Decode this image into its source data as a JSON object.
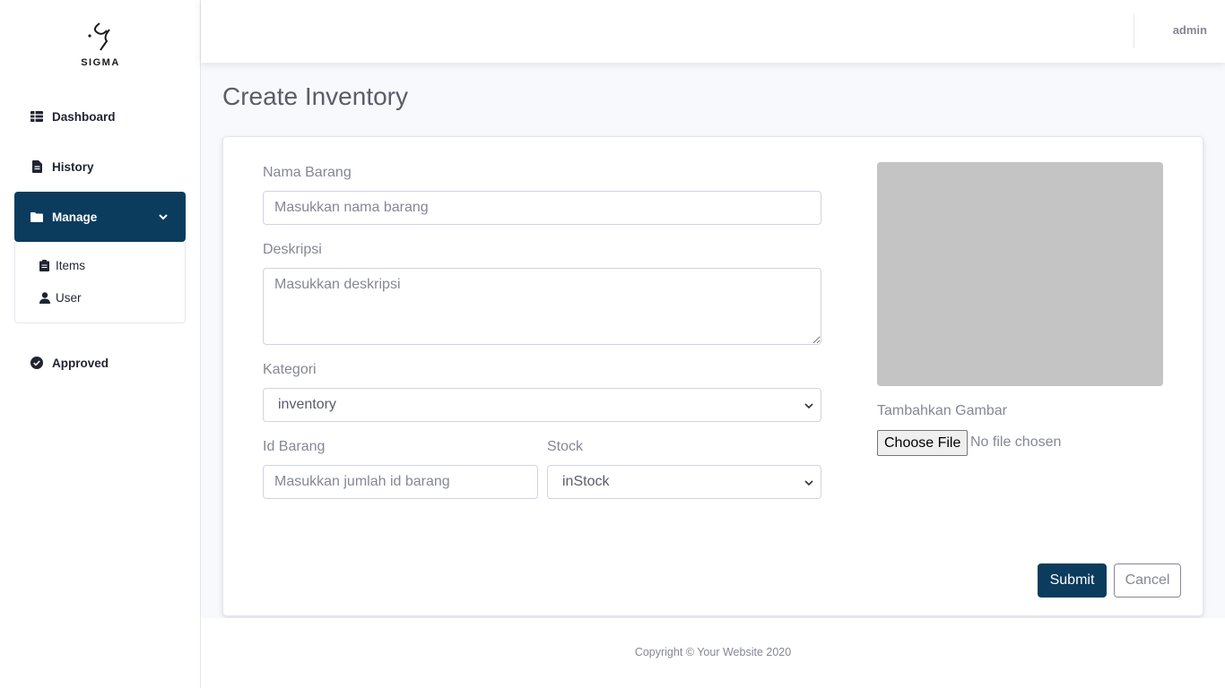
{
  "brand": {
    "name": "SIGMA",
    "logo_icon": "sigma-logo-icon"
  },
  "sidebar": {
    "items": [
      {
        "label": "Dashboard",
        "icon": "table-icon"
      },
      {
        "label": "History",
        "icon": "file-icon"
      },
      {
        "label": "Manage",
        "icon": "folder-icon",
        "expanded": true
      },
      {
        "label": "Approved",
        "icon": "check-circle-icon"
      }
    ],
    "manage_sub": [
      {
        "label": "Items",
        "icon": "clipboard-icon"
      },
      {
        "label": "User",
        "icon": "user-icon"
      }
    ]
  },
  "topbar": {
    "user": "admin"
  },
  "page": {
    "title": "Create Inventory"
  },
  "form": {
    "nama_label": "Nama Barang",
    "nama_placeholder": "Masukkan nama barang",
    "deskripsi_label": "Deskripsi",
    "deskripsi_placeholder": "Masukkan deskripsi",
    "kategori_label": "Kategori",
    "kategori_value": "inventory",
    "id_label": "Id Barang",
    "id_placeholder": "Masukkan jumlah id barang",
    "stock_label": "Stock",
    "stock_value": "inStock",
    "gambar_label": "Tambahkan Gambar",
    "file_button": "Choose File",
    "file_status": "No file chosen",
    "submit": "Submit",
    "cancel": "Cancel"
  },
  "colors": {
    "primary": "#0b3c5d",
    "muted": "#858796",
    "preview": "#c4c4c4"
  },
  "footer": {
    "text": "Copyright © Your Website 2020"
  }
}
